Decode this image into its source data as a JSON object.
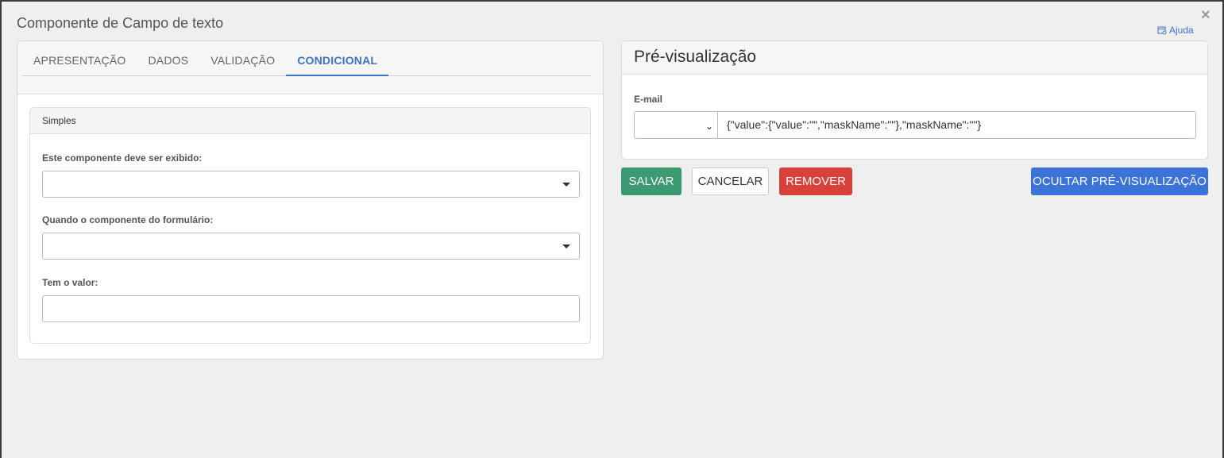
{
  "dialog": {
    "title": "Componente de Campo de texto",
    "close_label": "×",
    "help_label": "Ajuda"
  },
  "tabs": [
    {
      "label": "APRESENTAÇÃO",
      "active": false
    },
    {
      "label": "DADOS",
      "active": false
    },
    {
      "label": "VALIDAÇÃO",
      "active": false
    },
    {
      "label": "CONDICIONAL",
      "active": true
    }
  ],
  "conditional": {
    "legend": "Simples",
    "show_label": "Este componente deve ser exibido:",
    "show_value": "",
    "when_label": "Quando o componente do formulário:",
    "when_value": "",
    "value_label": "Tem o valor:",
    "value_value": ""
  },
  "preview": {
    "title": "Pré-visualização",
    "field_label": "E-mail",
    "mask_select_value": "",
    "field_value": "{\"value\":{\"value\":\"\",\"maskName\":\"\"},\"maskName\":\"\"}"
  },
  "actions": {
    "save": "SALVAR",
    "cancel": "CANCELAR",
    "remove": "REMOVER",
    "hide_preview": "OCULTAR PRÉ-VISUALIZAÇÃO"
  },
  "colors": {
    "accent": "#3b73c8",
    "save": "#3d9970",
    "remove": "#d9403a",
    "hide_preview": "#3b73d8"
  },
  "icons": {
    "close": "close-icon",
    "help": "help-icon",
    "select_caret": "caret-down-icon",
    "mask_chevron": "chevron-down-icon"
  }
}
